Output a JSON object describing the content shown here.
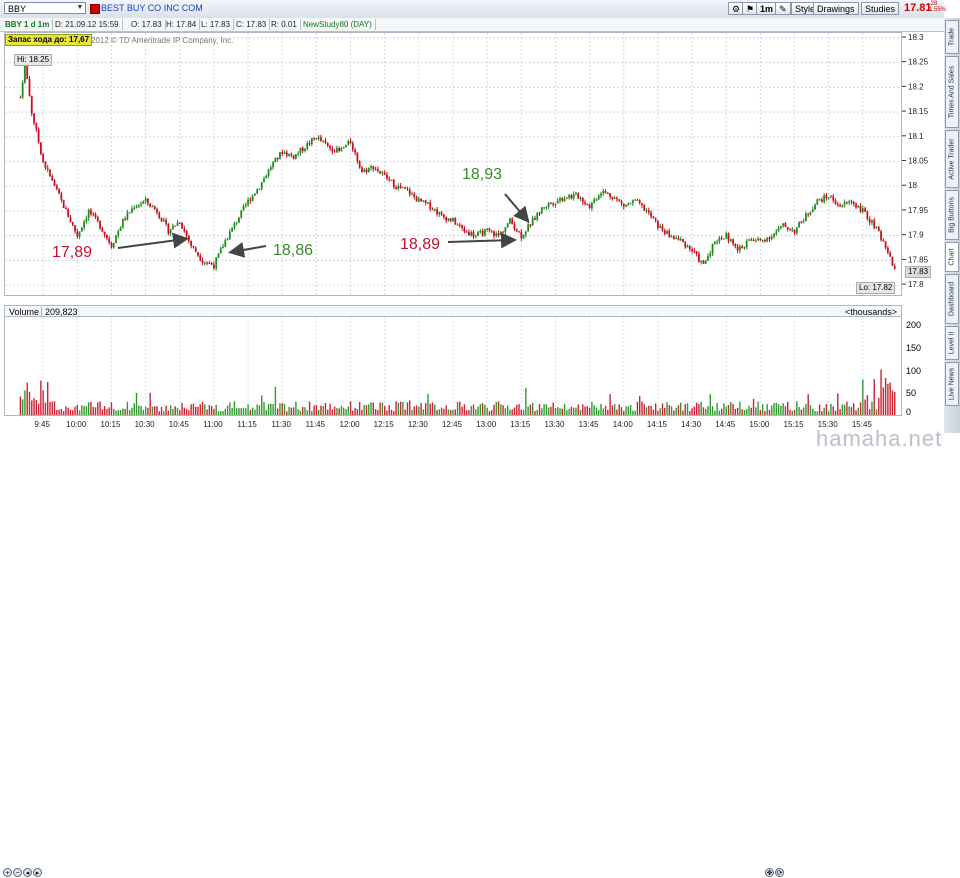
{
  "symbol": "BBY",
  "company": "BEST BUY CO INC COM",
  "toolbar": {
    "interval": "1m",
    "style_label": "Style",
    "drawings_label": "Drawings",
    "studies_label": "Studies",
    "last_price": "17.81",
    "change_abs": "-.28",
    "change_pct": "-1.55%"
  },
  "infobar": {
    "chart_label": "BBY 1 d 1m",
    "date": "D: 21.09.12 15:59",
    "open": "O: 17.83",
    "high": "H: 17.84",
    "low": "L: 17.83",
    "close": "C: 17.83",
    "range": "R: 0.01",
    "study": "NewStudy80 (DAY)"
  },
  "chart": {
    "copyright": "2012 © TD Ameritrade IP Company, Inc.",
    "study_badge": "Запас хода до: 17,67",
    "hi_tag": "Hi: 18.25",
    "lo_tag": "Lo: 17.82",
    "price_tag": "17.83"
  },
  "annotations": [
    {
      "text": "17,89",
      "color": "red"
    },
    {
      "text": "18,86",
      "color": "green"
    },
    {
      "text": "18,89",
      "color": "red"
    },
    {
      "text": "18,93",
      "color": "green"
    }
  ],
  "volume": {
    "label": "Volume",
    "value": "209,823",
    "units": "<thousands>",
    "ticks": [
      "200",
      "150",
      "100",
      "50",
      "0"
    ]
  },
  "sidebar_tabs": [
    "Trade",
    "Times And Sales",
    "Active Trader",
    "Big Buttons",
    "Chart",
    "Dashboard",
    "Level II",
    "Live News"
  ],
  "chart_data": {
    "type": "candlestick",
    "title": "BBY 1 d 1m",
    "x_tick_labels": [
      "9:45",
      "10:00",
      "10:15",
      "10:30",
      "10:45",
      "11:00",
      "11:15",
      "11:30",
      "11:45",
      "12:00",
      "12:15",
      "12:30",
      "12:45",
      "13:00",
      "13:15",
      "13:30",
      "13:45",
      "14:00",
      "14:15",
      "14:30",
      "14:45",
      "15:00",
      "15:15",
      "15:30",
      "15:45"
    ],
    "y_tick_labels": [
      "18.3",
      "18.25",
      "18.2",
      "18.15",
      "18.1",
      "18.05",
      "18",
      "17.95",
      "17.9",
      "17.85",
      "17.8"
    ],
    "ylim": [
      17.78,
      18.31
    ],
    "grid": true,
    "price_path": [
      {
        "t": "9:35",
        "p": 18.18
      },
      {
        "t": "9:37",
        "p": 18.25
      },
      {
        "t": "9:40",
        "p": 18.15
      },
      {
        "t": "9:45",
        "p": 18.05
      },
      {
        "t": "9:50",
        "p": 18.0
      },
      {
        "t": "9:55",
        "p": 17.95
      },
      {
        "t": "10:00",
        "p": 17.9
      },
      {
        "t": "10:05",
        "p": 17.95
      },
      {
        "t": "10:10",
        "p": 17.92
      },
      {
        "t": "10:15",
        "p": 17.88
      },
      {
        "t": "10:20",
        "p": 17.93
      },
      {
        "t": "10:25",
        "p": 17.96
      },
      {
        "t": "10:30",
        "p": 17.97
      },
      {
        "t": "10:35",
        "p": 17.95
      },
      {
        "t": "10:40",
        "p": 17.91
      },
      {
        "t": "10:45",
        "p": 17.93
      },
      {
        "t": "10:50",
        "p": 17.88
      },
      {
        "t": "10:55",
        "p": 17.85
      },
      {
        "t": "11:00",
        "p": 17.84
      },
      {
        "t": "11:05",
        "p": 17.89
      },
      {
        "t": "11:10",
        "p": 17.93
      },
      {
        "t": "11:15",
        "p": 17.97
      },
      {
        "t": "11:20",
        "p": 18.0
      },
      {
        "t": "11:25",
        "p": 18.04
      },
      {
        "t": "11:30",
        "p": 18.07
      },
      {
        "t": "11:35",
        "p": 18.06
      },
      {
        "t": "11:40",
        "p": 18.08
      },
      {
        "t": "11:45",
        "p": 18.1
      },
      {
        "t": "11:50",
        "p": 18.08
      },
      {
        "t": "11:55",
        "p": 18.07
      },
      {
        "t": "12:00",
        "p": 18.09
      },
      {
        "t": "12:05",
        "p": 18.03
      },
      {
        "t": "12:10",
        "p": 18.04
      },
      {
        "t": "12:15",
        "p": 18.02
      },
      {
        "t": "12:20",
        "p": 18.0
      },
      {
        "t": "12:25",
        "p": 17.99
      },
      {
        "t": "12:30",
        "p": 17.97
      },
      {
        "t": "12:35",
        "p": 17.96
      },
      {
        "t": "12:40",
        "p": 17.94
      },
      {
        "t": "12:45",
        "p": 17.93
      },
      {
        "t": "12:50",
        "p": 17.91
      },
      {
        "t": "12:55",
        "p": 17.9
      },
      {
        "t": "13:00",
        "p": 17.91
      },
      {
        "t": "13:05",
        "p": 17.9
      },
      {
        "t": "13:10",
        "p": 17.93
      },
      {
        "t": "13:15",
        "p": 17.9
      },
      {
        "t": "13:20",
        "p": 17.93
      },
      {
        "t": "13:25",
        "p": 17.96
      },
      {
        "t": "13:30",
        "p": 17.97
      },
      {
        "t": "13:35",
        "p": 17.98
      },
      {
        "t": "13:40",
        "p": 17.98
      },
      {
        "t": "13:45",
        "p": 17.96
      },
      {
        "t": "13:50",
        "p": 17.99
      },
      {
        "t": "13:55",
        "p": 17.98
      },
      {
        "t": "14:00",
        "p": 17.96
      },
      {
        "t": "14:05",
        "p": 17.97
      },
      {
        "t": "14:10",
        "p": 17.95
      },
      {
        "t": "14:15",
        "p": 17.92
      },
      {
        "t": "14:20",
        "p": 17.9
      },
      {
        "t": "14:25",
        "p": 17.89
      },
      {
        "t": "14:30",
        "p": 17.87
      },
      {
        "t": "14:35",
        "p": 17.84
      },
      {
        "t": "14:40",
        "p": 17.89
      },
      {
        "t": "14:45",
        "p": 17.9
      },
      {
        "t": "14:50",
        "p": 17.87
      },
      {
        "t": "14:55",
        "p": 17.89
      },
      {
        "t": "15:00",
        "p": 17.89
      },
      {
        "t": "15:05",
        "p": 17.9
      },
      {
        "t": "15:10",
        "p": 17.92
      },
      {
        "t": "15:15",
        "p": 17.91
      },
      {
        "t": "15:20",
        "p": 17.94
      },
      {
        "t": "15:25",
        "p": 17.97
      },
      {
        "t": "15:30",
        "p": 17.98
      },
      {
        "t": "15:35",
        "p": 17.96
      },
      {
        "t": "15:40",
        "p": 17.97
      },
      {
        "t": "15:45",
        "p": 17.95
      },
      {
        "t": "15:50",
        "p": 17.92
      },
      {
        "t": "15:55",
        "p": 17.88
      },
      {
        "t": "15:59",
        "p": 17.83
      }
    ]
  }
}
